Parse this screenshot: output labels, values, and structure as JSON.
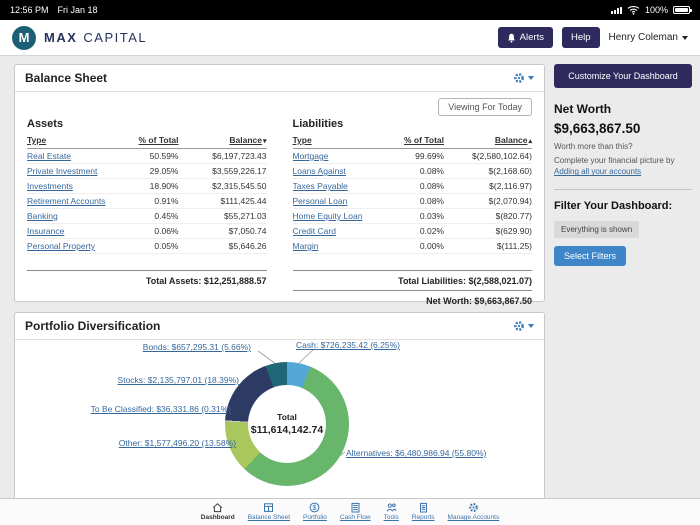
{
  "colors": {
    "brand_navy": "#2f2a5e",
    "link_blue": "#36689c",
    "button_blue": "#3e86c7",
    "gear_blue": "#3a78b5",
    "logo_teal": "#1d5f74"
  },
  "status_bar": {
    "time": "12:56 PM",
    "date": "Fri Jan 18",
    "battery_pct": "100%"
  },
  "header": {
    "brand_word1": "MAX",
    "brand_word2": "CAPITAL",
    "logo_letter": "M",
    "alerts_label": "Alerts",
    "help_label": "Help",
    "user_name": "Henry Coleman"
  },
  "balance_sheet": {
    "title": "Balance Sheet",
    "viewing_button": "Viewing For Today",
    "assets": {
      "heading": "Assets",
      "col_type": "Type",
      "col_pct": "% of Total",
      "col_balance": "Balance",
      "sort_arrow": "▾",
      "rows": [
        {
          "type": "Real Estate",
          "pct": "50.59%",
          "balance": "$6,197,723.43"
        },
        {
          "type": "Private Investment",
          "pct": "29.05%",
          "balance": "$3,559,226.17"
        },
        {
          "type": "Investments",
          "pct": "18.90%",
          "balance": "$2,315,545.50"
        },
        {
          "type": "Retirement Accounts",
          "pct": "0.91%",
          "balance": "$111,425.44"
        },
        {
          "type": "Banking",
          "pct": "0.45%",
          "balance": "$55,271.03"
        },
        {
          "type": "Insurance",
          "pct": "0.06%",
          "balance": "$7,050.74"
        },
        {
          "type": "Personal Property",
          "pct": "0.05%",
          "balance": "$5,646.26"
        }
      ],
      "total": "Total Assets: $12,251,888.57"
    },
    "liabilities": {
      "heading": "Liabilities",
      "col_type": "Type",
      "col_pct": "% of Total",
      "col_balance": "Balance",
      "sort_arrow": "▴",
      "rows": [
        {
          "type": "Mortgage",
          "pct": "99.69%",
          "balance": "$(2,580,102.64)"
        },
        {
          "type": "Loans Against",
          "pct": "0.08%",
          "balance": "$(2,168.60)"
        },
        {
          "type": "Taxes Payable",
          "pct": "0.08%",
          "balance": "$(2,116.97)"
        },
        {
          "type": "Personal Loan",
          "pct": "0.08%",
          "balance": "$(2,070.94)"
        },
        {
          "type": "Home Equity Loan",
          "pct": "0.03%",
          "balance": "$(820.77)"
        },
        {
          "type": "Credit Card",
          "pct": "0.02%",
          "balance": "$(629.90)"
        },
        {
          "type": "Margin",
          "pct": "0.00%",
          "balance": "$(111.25)"
        }
      ],
      "total": "Total Liabilities: $(2,588,021.07)",
      "net_worth": "Net Worth: $9,663,867.50"
    }
  },
  "sidebar": {
    "customize_button": "Customize Your Dashboard",
    "net_worth_label": "Net Worth",
    "net_worth_value": "$9,663,867.50",
    "worth_more_hint": "Worth more than this?",
    "complete_text": "Complete your financial picture by",
    "add_accounts_link": "Adding all your accounts",
    "filter_label": "Filter Your Dashboard:",
    "filter_status": "Everything is shown",
    "select_filters_button": "Select Filters"
  },
  "portfolio": {
    "title": "Portfolio Diversification"
  },
  "chart_data": {
    "type": "pie",
    "title": "Portfolio Diversification",
    "center_label": "Total",
    "center_value": "$11,614,142.74",
    "total_value": 11614142.74,
    "legend_position": "callout-labels-around-donut",
    "slices": [
      {
        "name": "Cash",
        "value": 726235.42,
        "pct": 6.25,
        "label": "Cash: $726,235.42 (6.25%)",
        "color": "#55a7d5"
      },
      {
        "name": "Alternatives",
        "value": 6480986.94,
        "pct": 55.8,
        "label": "Alternatives: $6,480,986.94 (55.80%)",
        "color": "#68b56c"
      },
      {
        "name": "Other",
        "value": 1577496.2,
        "pct": 13.58,
        "label": "Other: $1,577,496.20 (13.58%)",
        "color": "#a9c75c"
      },
      {
        "name": "To Be Classified",
        "value": 36331.86,
        "pct": 0.31,
        "label": "To Be Classified: $36,331.86 (0.31%)",
        "color": "#c9c9c9"
      },
      {
        "name": "Stocks",
        "value": 2135797.01,
        "pct": 18.39,
        "label": "Stocks: $2,135,797.01 (18.39%)",
        "color": "#2c3a64"
      },
      {
        "name": "Bonds",
        "value": 657295.31,
        "pct": 5.66,
        "label": "Bonds: $657,295.31 (5.66%)",
        "color": "#1f6878"
      }
    ]
  },
  "tab_bar": {
    "items": [
      {
        "label": "Dashboard",
        "active": true
      },
      {
        "label": "Balance Sheet",
        "active": false
      },
      {
        "label": "Portfolio",
        "active": false
      },
      {
        "label": "Cash Flow",
        "active": false
      },
      {
        "label": "Tools",
        "active": false
      },
      {
        "label": "Reports",
        "active": false
      },
      {
        "label": "Manage Accounts",
        "active": false
      }
    ]
  }
}
